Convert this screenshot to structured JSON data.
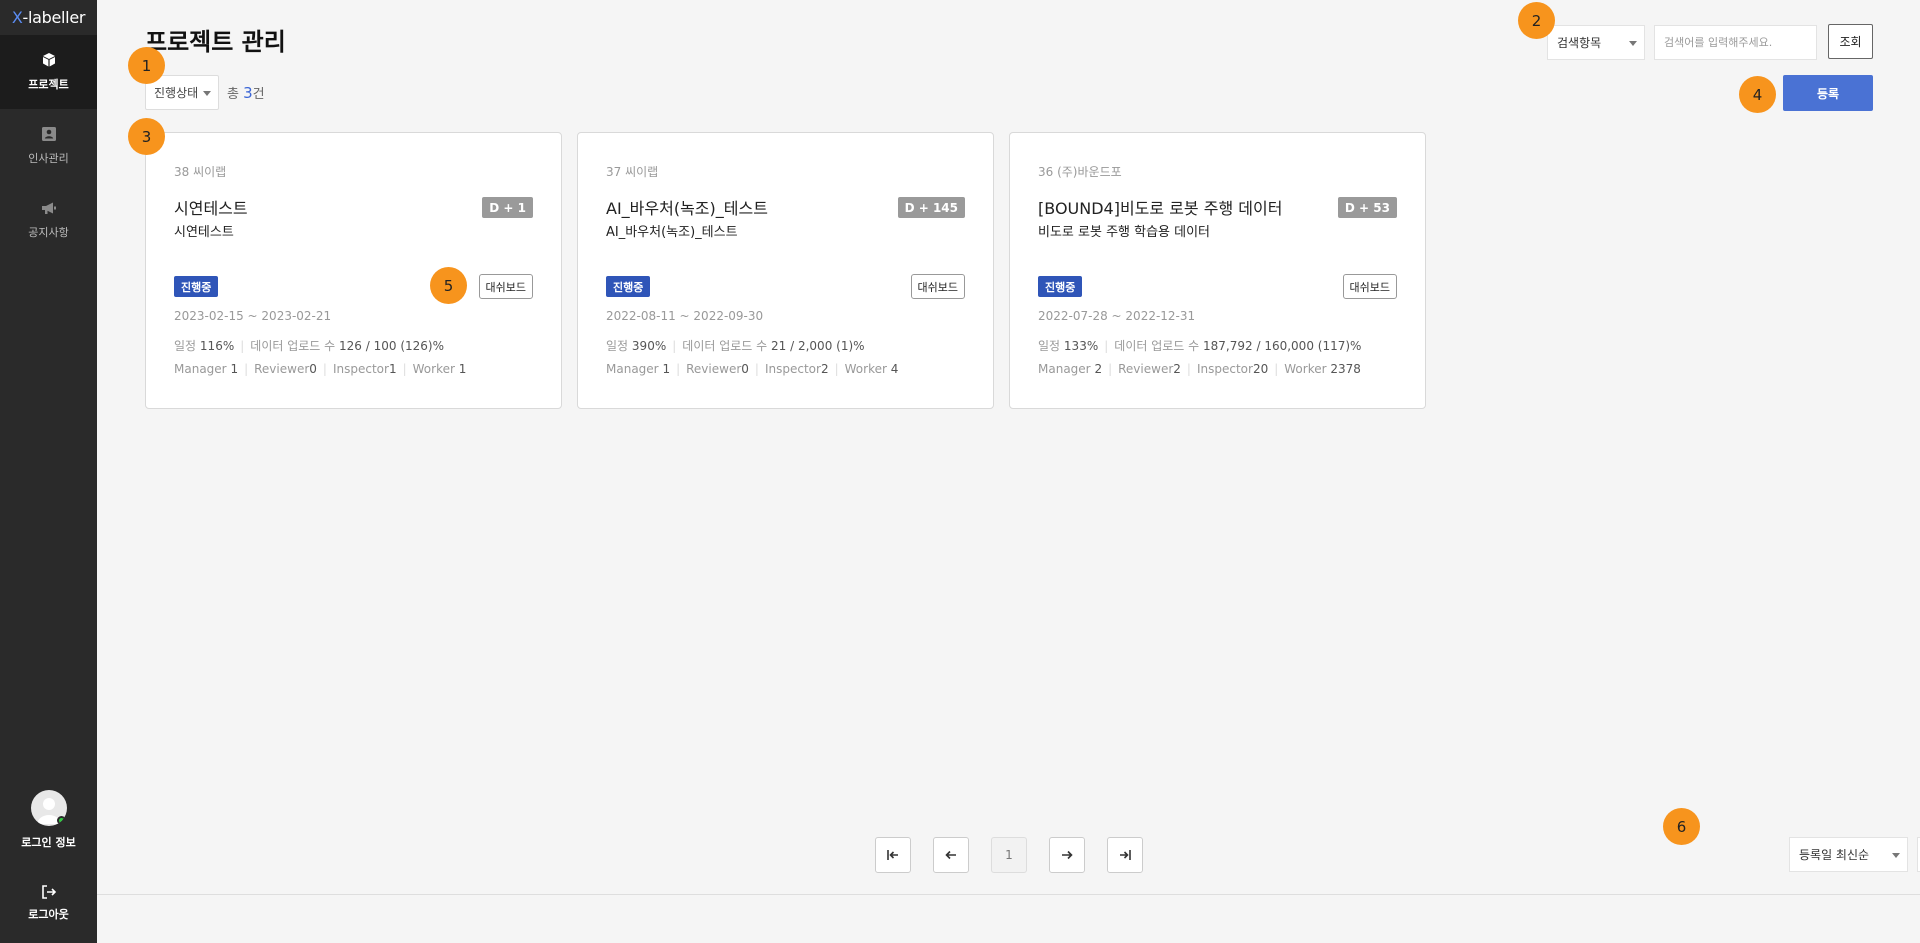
{
  "app": {
    "logo_x": "X",
    "logo_rest": "-labeller"
  },
  "sidebar": {
    "items": [
      {
        "label": "프로젝트",
        "icon": "cube-icon",
        "active": true
      },
      {
        "label": "인사관리",
        "icon": "person-card-icon",
        "active": false
      },
      {
        "label": "공지사항",
        "icon": "megaphone-icon",
        "active": false
      }
    ],
    "user_label": "로그인 정보",
    "logout_label": "로그아웃"
  },
  "page": {
    "title": "프로젝트 관리"
  },
  "filters": {
    "status_select": "진행상태",
    "total_prefix": "총",
    "total_count": "3",
    "total_suffix": "건",
    "search_select": "검색항목",
    "search_placeholder": "검색어를 입력해주세요.",
    "search_button": "조회",
    "register_button": "등록"
  },
  "cards": [
    {
      "no": "38 씨이랩",
      "title": "시연테스트",
      "subtitle": "시연테스트",
      "dday": "D + 1",
      "state": "진행중",
      "dashboard": "대쉬보드",
      "period": "2023-02-15 ~ 2023-02-21",
      "schedule_label": "일정",
      "schedule": "116",
      "upload_label": "데이터 업로드 수",
      "upload": "126 / 100 (126)",
      "manager": "1",
      "reviewer": "0",
      "inspector": "1",
      "worker": "1"
    },
    {
      "no": "37 씨이랩",
      "title": "AI_바우처(녹조)_테스트",
      "subtitle": "AI_바우처(녹조)_테스트",
      "dday": "D + 145",
      "state": "진행중",
      "dashboard": "대쉬보드",
      "period": "2022-08-11 ~ 2022-09-30",
      "schedule_label": "일정",
      "schedule": "390",
      "upload_label": "데이터 업로드 수",
      "upload": "21 / 2,000 (1)",
      "manager": "1",
      "reviewer": "0",
      "inspector": "2",
      "worker": "4"
    },
    {
      "no": "36 (주)바운드포",
      "title": "[BOUND4]비도로 로봇 주행 데이터",
      "subtitle": "비도로 로봇 주행 학습용 데이터",
      "dday": "D + 53",
      "state": "진행중",
      "dashboard": "대쉬보드",
      "period": "2022-07-28 ~ 2022-12-31",
      "schedule_label": "일정",
      "schedule": "133",
      "upload_label": "데이터 업로드 수",
      "upload": "187,792 / 160,000 (117)",
      "manager": "2",
      "reviewer": "2",
      "inspector": "20",
      "worker": "2378"
    }
  ],
  "role_labels": {
    "manager": "Manager",
    "reviewer": "Reviewer",
    "inspector": "Inspector",
    "worker": "Worker",
    "percent": "%"
  },
  "pagination": {
    "first_icon": "first-page-icon",
    "prev_icon": "arrow-left-icon",
    "current": "1",
    "next_icon": "arrow-right-icon",
    "last_icon": "last-page-icon",
    "sort": "등록일 최신순",
    "page_size": "10"
  },
  "markers": [
    "1",
    "2",
    "3",
    "4",
    "5",
    "6"
  ],
  "colors": {
    "accent": "#4a72d4",
    "state_badge": "#2f55b8",
    "marker": "#f7941d",
    "sidebar": "#2a2a2a"
  }
}
